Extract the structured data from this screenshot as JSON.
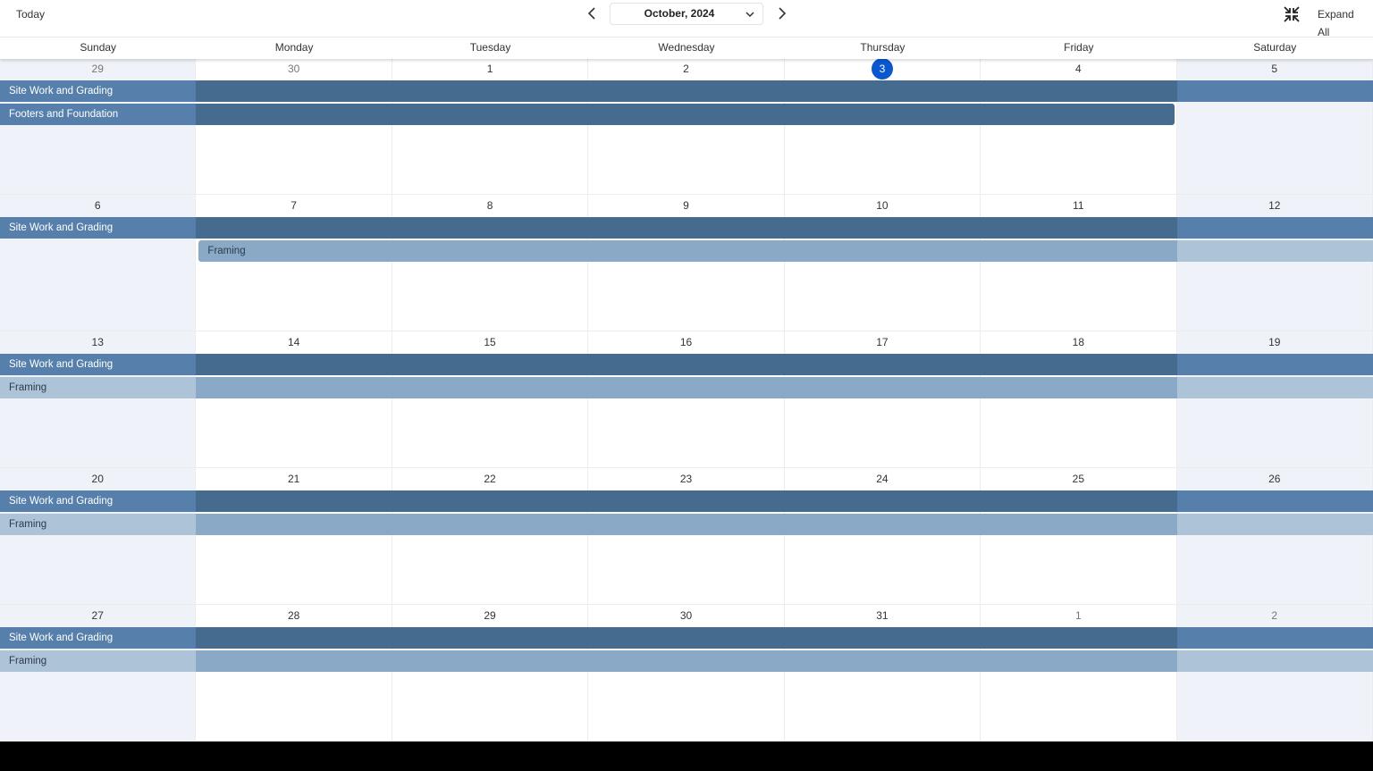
{
  "toolbar": {
    "today_label": "Today",
    "month_label": "October, 2024",
    "expand_all_label": "Expand All"
  },
  "icons": {
    "prev": "chevron-left-icon",
    "next": "chevron-right-icon",
    "dropdown": "chevron-down-icon",
    "collapse": "collapse-arrows-icon"
  },
  "colors": {
    "site_work_main": "#456b8f",
    "site_work_edge": "#5680ab",
    "footers": "#456b8f",
    "footers_label": "#5680ab",
    "framing_main": "#8aa9c6",
    "framing_edge": "#adc3d8",
    "today_circle": "#0b57d0",
    "weekend_bg": "#eff2f9"
  },
  "weekdays": [
    "Sunday",
    "Monday",
    "Tuesday",
    "Wednesday",
    "Thursday",
    "Friday",
    "Saturday"
  ],
  "weeks": [
    {
      "days": [
        "29",
        "30",
        "1",
        "2",
        "3",
        "4",
        "5"
      ],
      "other_month": [
        true,
        true,
        false,
        false,
        false,
        false,
        false
      ],
      "today_index": 4,
      "events": [
        {
          "label": "Site Work and Grading",
          "type": "site"
        },
        {
          "label": "Footers and Foundation",
          "type": "footers"
        }
      ]
    },
    {
      "days": [
        "6",
        "7",
        "8",
        "9",
        "10",
        "11",
        "12"
      ],
      "other_month": [
        false,
        false,
        false,
        false,
        false,
        false,
        false
      ],
      "today_index": -1,
      "events": [
        {
          "label": "Site Work and Grading",
          "type": "site"
        },
        {
          "label": "Framing",
          "type": "framing_start"
        }
      ]
    },
    {
      "days": [
        "13",
        "14",
        "15",
        "16",
        "17",
        "18",
        "19"
      ],
      "other_month": [
        false,
        false,
        false,
        false,
        false,
        false,
        false
      ],
      "today_index": -1,
      "events": [
        {
          "label": "Site Work and Grading",
          "type": "site"
        },
        {
          "label": "Framing",
          "type": "framing"
        }
      ]
    },
    {
      "days": [
        "20",
        "21",
        "22",
        "23",
        "24",
        "25",
        "26"
      ],
      "other_month": [
        false,
        false,
        false,
        false,
        false,
        false,
        false
      ],
      "today_index": -1,
      "events": [
        {
          "label": "Site Work and Grading",
          "type": "site"
        },
        {
          "label": "Framing",
          "type": "framing"
        }
      ]
    },
    {
      "days": [
        "27",
        "28",
        "29",
        "30",
        "31",
        "1",
        "2"
      ],
      "other_month": [
        false,
        false,
        false,
        false,
        false,
        true,
        true
      ],
      "today_index": -1,
      "events": [
        {
          "label": "Site Work and Grading",
          "type": "site"
        },
        {
          "label": "Framing",
          "type": "framing"
        }
      ]
    }
  ]
}
